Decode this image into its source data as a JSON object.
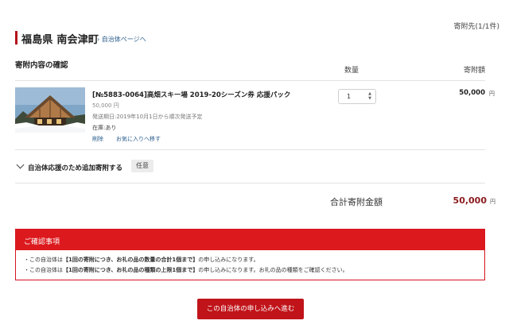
{
  "header": {
    "donation_count": "寄附先(1/1件)",
    "municipality_name": "福島県 南会津町",
    "municipality_link": "› 自治体ページへ"
  },
  "cart": {
    "section_title": "寄附内容の確認",
    "col_quantity": "数量",
    "col_amount": "寄附額",
    "item": {
      "title": "[№5883-0064]高畑スキー場 2019-20シーズン券 応援パック",
      "price": "50,000 円",
      "shipping": "発送期日:2019年10月1日から順次発送予定",
      "stock": "在庫:あり",
      "delete_label": "削除",
      "favorite_label": "お気に入りへ移す",
      "quantity": "1",
      "amount": "50,000",
      "amount_unit": "円",
      "image_icon": "lodge-photo"
    },
    "extra_donation": {
      "label": "自治体応援のため追加寄附する",
      "badge": "任意",
      "icon": "chevron-down-icon"
    },
    "total": {
      "label": "合計寄附金額",
      "value": "50,000",
      "unit": "円"
    }
  },
  "notice": {
    "title": "ご確認事項",
    "line1_pre": "・この自治体は",
    "line1_bold": "【1回の寄附につき、お礼の品の数量の合計1個まで】",
    "line1_post": "の申し込みになります。",
    "line2_pre": "・この自治体は",
    "line2_bold": "【1回の寄附につき、お礼の品の種類の上限1個まで】",
    "line2_post": "の申し込みになります。お礼の品の種類をご確認ください。"
  },
  "cta": {
    "label": "この自治体の申し込みへ進む"
  },
  "colors": {
    "accent": "#dc1a1e",
    "button": "#c0141a",
    "total_value": "#8b1b1f",
    "link": "#2a5d8c"
  }
}
